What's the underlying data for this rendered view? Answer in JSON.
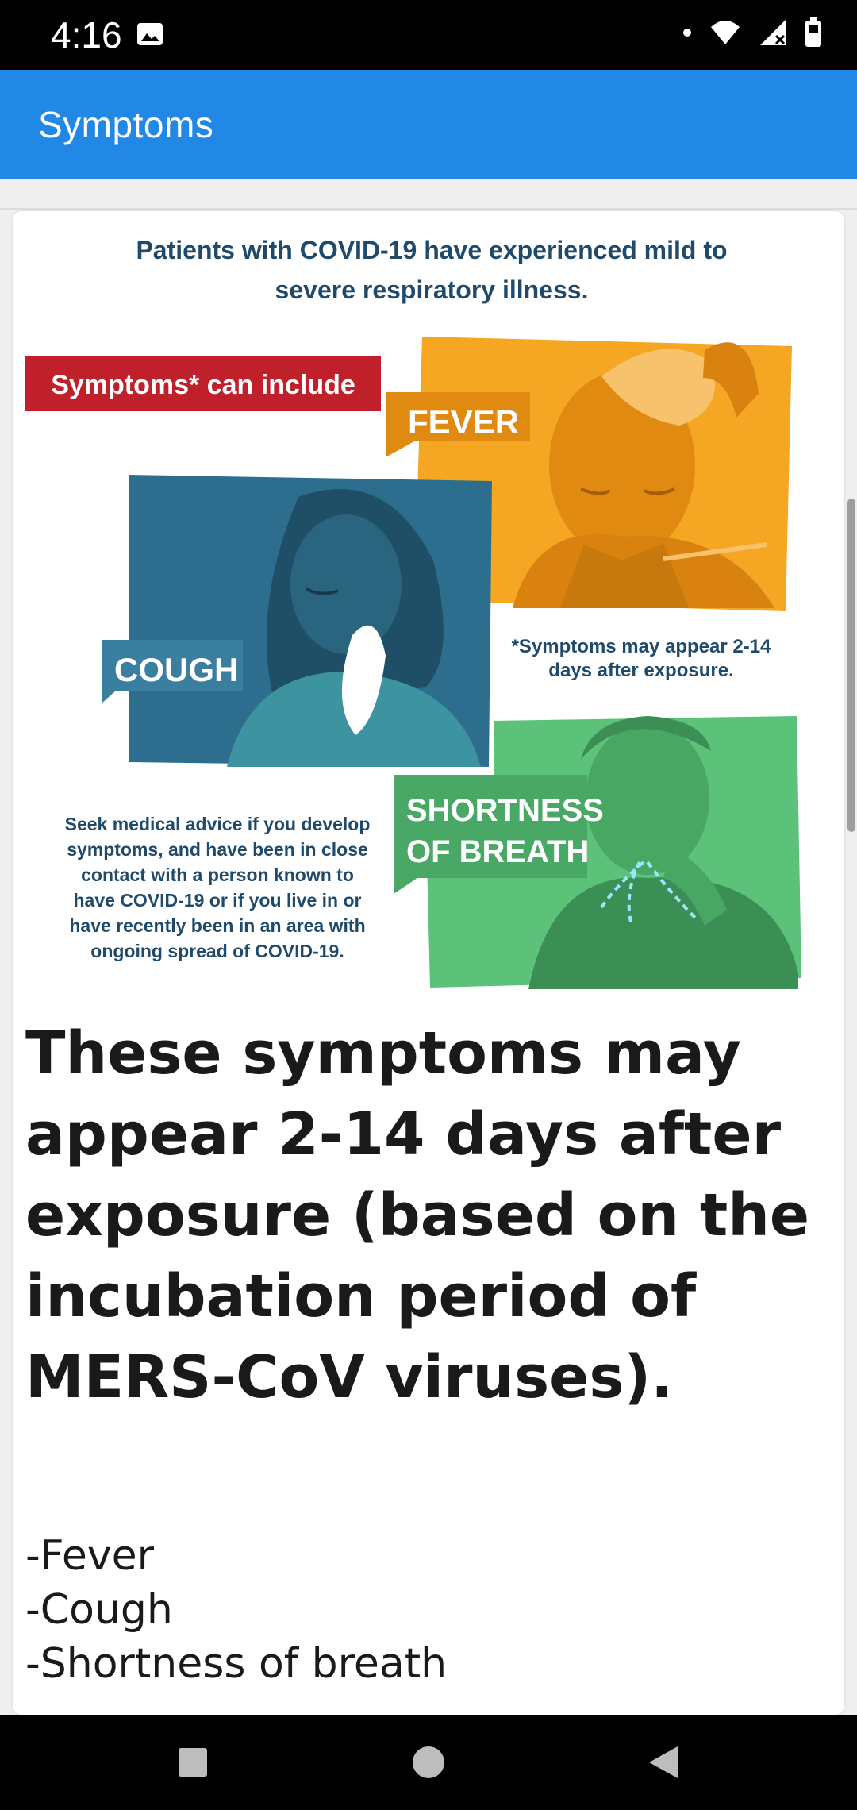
{
  "status_bar": {
    "time": "4:16",
    "icons": [
      "gallery-icon",
      "notification-dot-icon",
      "wifi-icon",
      "cell-signal-icon",
      "battery-icon"
    ]
  },
  "app_bar": {
    "title": "Symptoms"
  },
  "infographic": {
    "heading_line1": "Patients with COVID-19 have experienced mild to",
    "heading_line2": "severe respiratory illness.",
    "banner": "Symptoms* can include",
    "fever": "FEVER",
    "cough": "COUGH",
    "breath_line1": "SHORTNESS",
    "breath_line2": "OF BREATH",
    "footnote_line1": "*Symptoms may appear 2-14",
    "footnote_line2": "days after exposure.",
    "advice_lines": [
      "Seek medical advice if you develop",
      "symptoms, and have been in close",
      "contact with a person known to",
      "have COVID-19 or if you live in or",
      "have recently been in an area with",
      "ongoing spread of COVID-19."
    ],
    "colors": {
      "banner_red": "#c0202a",
      "fever_orange": "#f5a623",
      "cough_blue": "#2d6e8e",
      "breath_green": "#5cc27a",
      "heading_navy": "#1f4a6b"
    }
  },
  "headline_lines": [
    "These symptoms may",
    "appear 2-14 days after",
    "exposure (based on the",
    "incubation period of",
    "MERS-CoV viruses)."
  ],
  "symptoms": [
    "-Fever",
    "-Cough",
    "-Shortness of breath"
  ],
  "nav_bar": {
    "buttons": [
      "recents-button",
      "home-button",
      "back-button"
    ]
  }
}
